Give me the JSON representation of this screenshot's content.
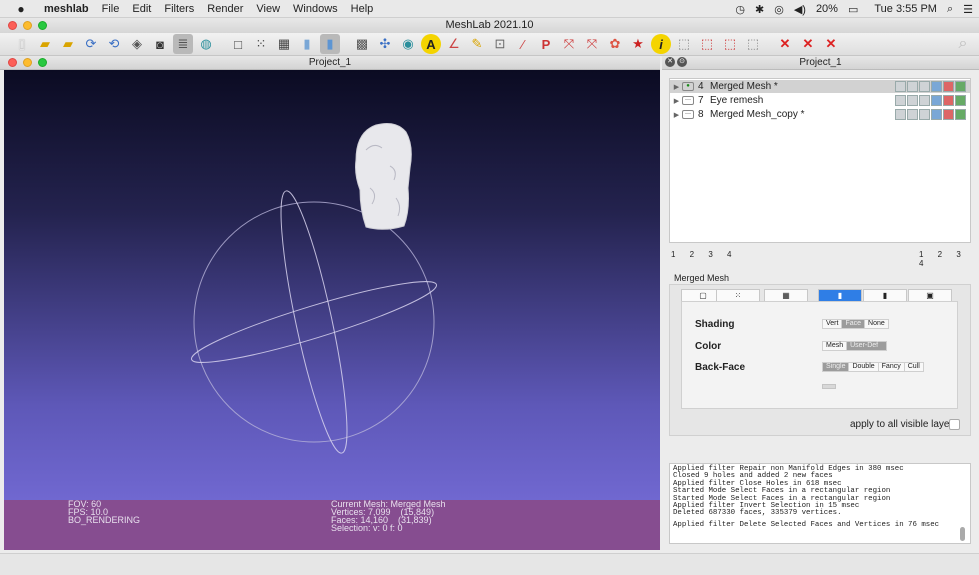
{
  "menubar": {
    "app_name": "meshlab",
    "menus": [
      "File",
      "Edit",
      "Filters",
      "Render",
      "View",
      "Windows",
      "Help"
    ],
    "battery": "20%",
    "clock": "Tue 3:55 PM"
  },
  "window": {
    "title": "MeshLab 2021.10"
  },
  "project": {
    "title": "Project_1"
  },
  "right_panel": {
    "title": "Project_1"
  },
  "layers": [
    {
      "num": "4",
      "name": "Merged Mesh *",
      "selected": true
    },
    {
      "num": "7",
      "name": "Eye remesh",
      "selected": false
    },
    {
      "num": "8",
      "name": "Merged Mesh_copy *",
      "selected": false
    }
  ],
  "pagination_left": "1 2 3 4",
  "pagination_right": "1 2 3 4",
  "decorator": {
    "mesh_name": "Merged Mesh",
    "shading_label": "Shading",
    "shading_options": [
      "Vert",
      "Face",
      "None"
    ],
    "shading_selected": "Face",
    "color_label": "Color",
    "color_options": [
      "Mesh",
      "User-Def"
    ],
    "color_selected": "User-Def",
    "backface_label": "Back-Face",
    "backface_options": [
      "Single",
      "Double",
      "Fancy",
      "Cull"
    ],
    "backface_selected": "Single",
    "apply_all_label": "apply to all visible layers"
  },
  "viewport_info": {
    "fov": "FOV: 60",
    "fps": "FPS:   10.0",
    "rendering": "BO_RENDERING",
    "current_mesh": "Current Mesh: Merged Mesh",
    "vertices": "Vertices: 7,099    (15,849)",
    "faces": "Faces: 14,160    (31,839)",
    "selection": "Selection: v: 0 f: 0"
  },
  "log": [
    "Applied filter Repair non Manifold Edges in 380 msec",
    "Closed 9 holes and added 2 new faces",
    "Applied filter Close Holes in 618 msec",
    "Started Mode Select Faces in a rectangular region",
    "Started Mode Select Faces in a rectangular region",
    "Applied filter Invert Selection in 15 msec",
    "Deleted 687330 faces, 335379 vertices.",
    "",
    "Applied filter Delete Selected Faces and Vertices in 76 msec"
  ]
}
